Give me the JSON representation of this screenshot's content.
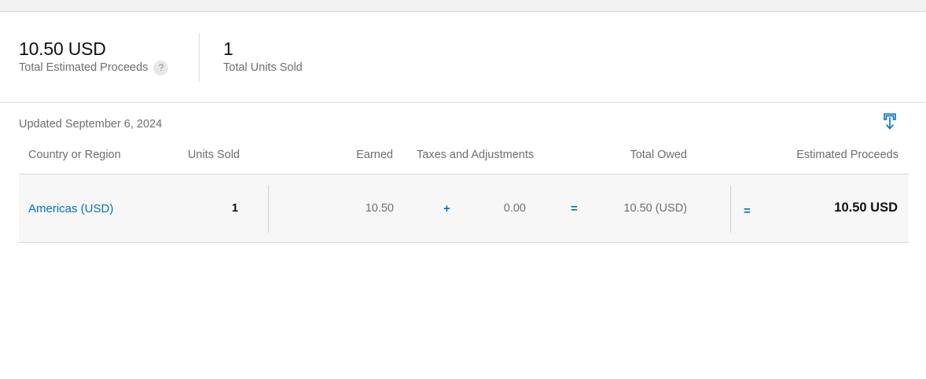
{
  "summary": {
    "proceeds_value": "10.50 USD",
    "proceeds_label": "Total Estimated Proceeds",
    "help_glyph": "?",
    "units_value": "1",
    "units_label": "Total Units Sold"
  },
  "table": {
    "updated_text": "Updated September 6, 2024",
    "download_icon": "download-icon",
    "columns": {
      "region": "Country or Region",
      "units": "Units Sold",
      "earned": "Earned",
      "taxes": "Taxes and Adjustments",
      "total_owed": "Total Owed",
      "proceeds": "Estimated Proceeds"
    },
    "rows": [
      {
        "region": "Americas (USD)",
        "units": "1",
        "earned": "10.50",
        "plus": "+",
        "taxes": "0.00",
        "equals": "=",
        "total_owed": "10.50 (USD)",
        "equals2": "=",
        "proceeds": "10.50 USD"
      }
    ]
  },
  "colors": {
    "accent": "#0070c9",
    "muted_text": "#6e6e73",
    "row_bg": "#f7f7f7"
  }
}
